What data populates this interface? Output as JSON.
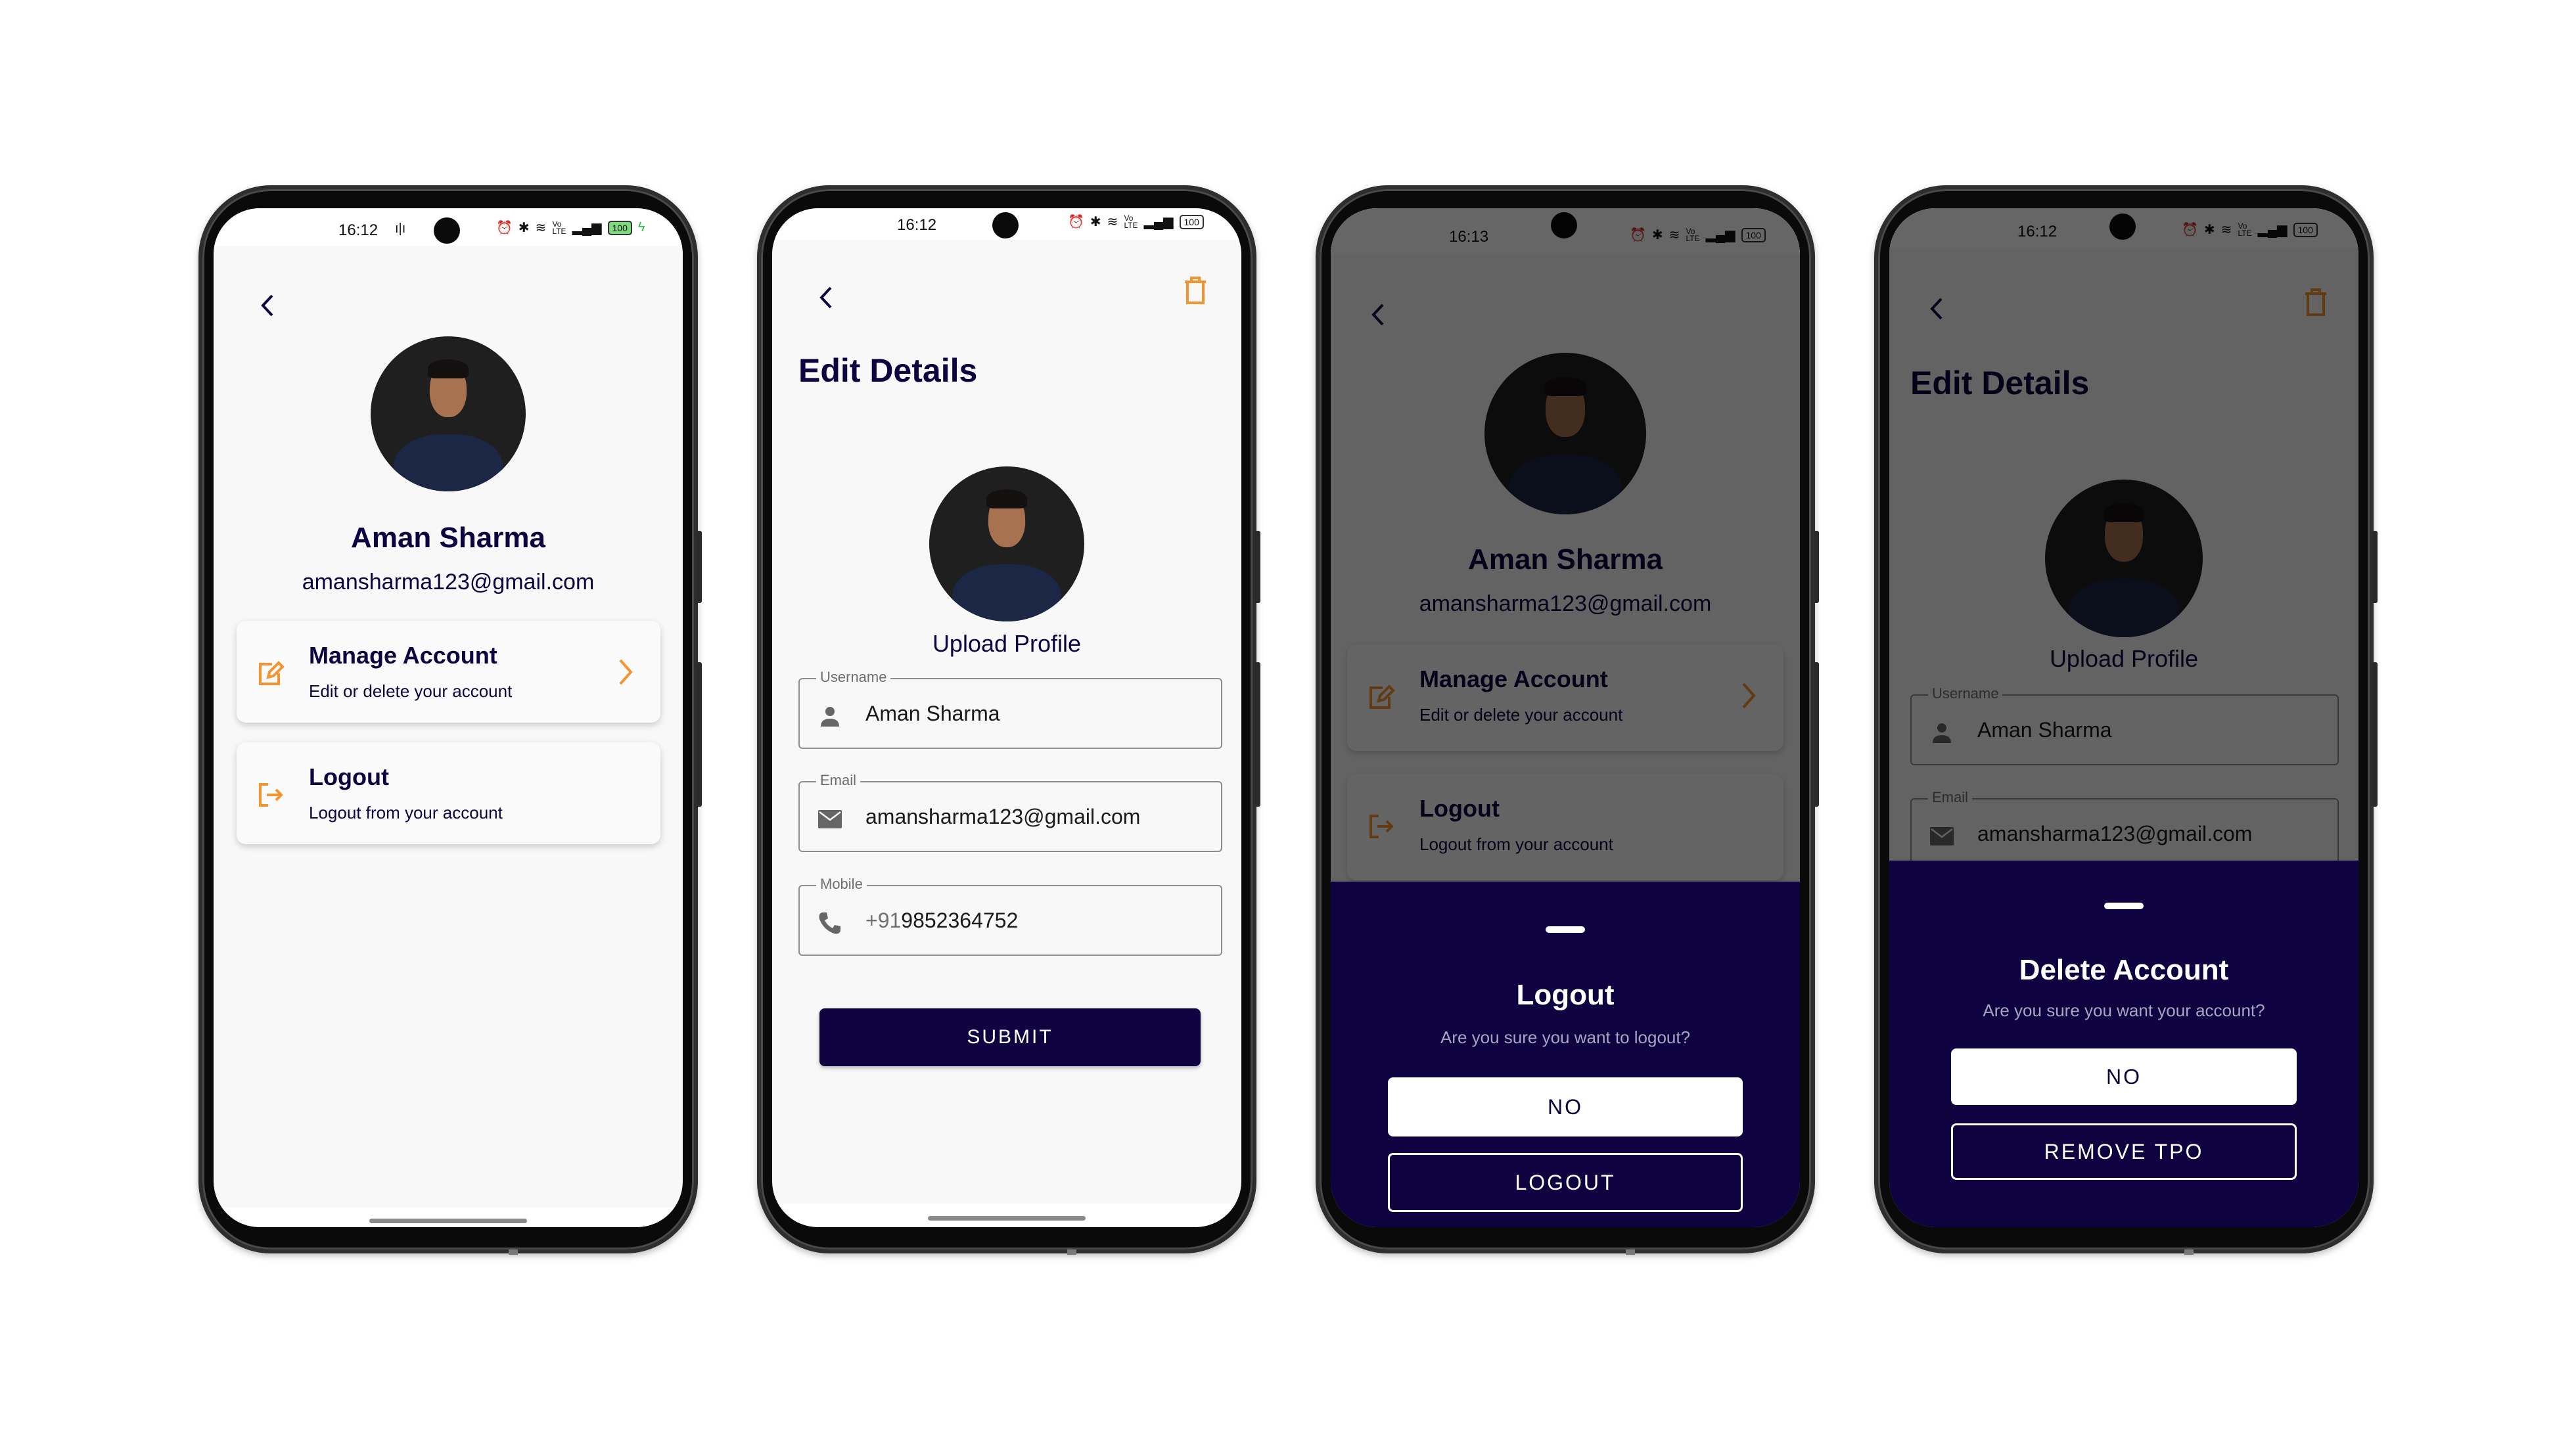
{
  "colors": {
    "navy": "#0e0340",
    "accent": "#f59331",
    "background": "#f8f8f8"
  },
  "profile": {
    "name": "Aman Sharma",
    "email": "amansharma123@gmail.com",
    "mobile_prefix": "+91",
    "mobile": "9852364752"
  },
  "screens": [
    {
      "id": "profile",
      "status": {
        "time": "16:12",
        "battery": "100",
        "extra": "ı|ı"
      },
      "back_icon": "chevron-left-icon",
      "menu": [
        {
          "icon": "edit-icon",
          "title": "Manage Account",
          "subtitle": "Edit or delete your account",
          "trailing": "chevron-right-icon"
        },
        {
          "icon": "logout-icon",
          "title": "Logout",
          "subtitle": "Logout from your account"
        }
      ]
    },
    {
      "id": "edit-details",
      "status": {
        "time": "16:12",
        "battery": "100"
      },
      "title": "Edit Details",
      "upload_label": "Upload Profile",
      "fields": [
        {
          "label": "Username",
          "icon": "person-icon",
          "value": "Aman Sharma"
        },
        {
          "label": "Email",
          "icon": "mail-icon",
          "value": "amansharma123@gmail.com"
        },
        {
          "label": "Mobile",
          "icon": "phone-icon",
          "prefix": "+91",
          "value": "9852364752"
        }
      ],
      "submit_label": "SUBMIT",
      "delete_icon": "trash-icon"
    },
    {
      "id": "logout-sheet",
      "status": {
        "time": "16:13",
        "battery": "100"
      },
      "sheet": {
        "title": "Logout",
        "message": "Are you sure you want to logout?",
        "primary": "NO",
        "secondary": "LOGOUT"
      }
    },
    {
      "id": "delete-sheet",
      "status": {
        "time": "16:12",
        "battery": "100"
      },
      "sheet": {
        "title": "Delete Account",
        "message": "Are you sure you want your account?",
        "primary": "NO",
        "secondary": "REMOVE TPO"
      }
    }
  ]
}
